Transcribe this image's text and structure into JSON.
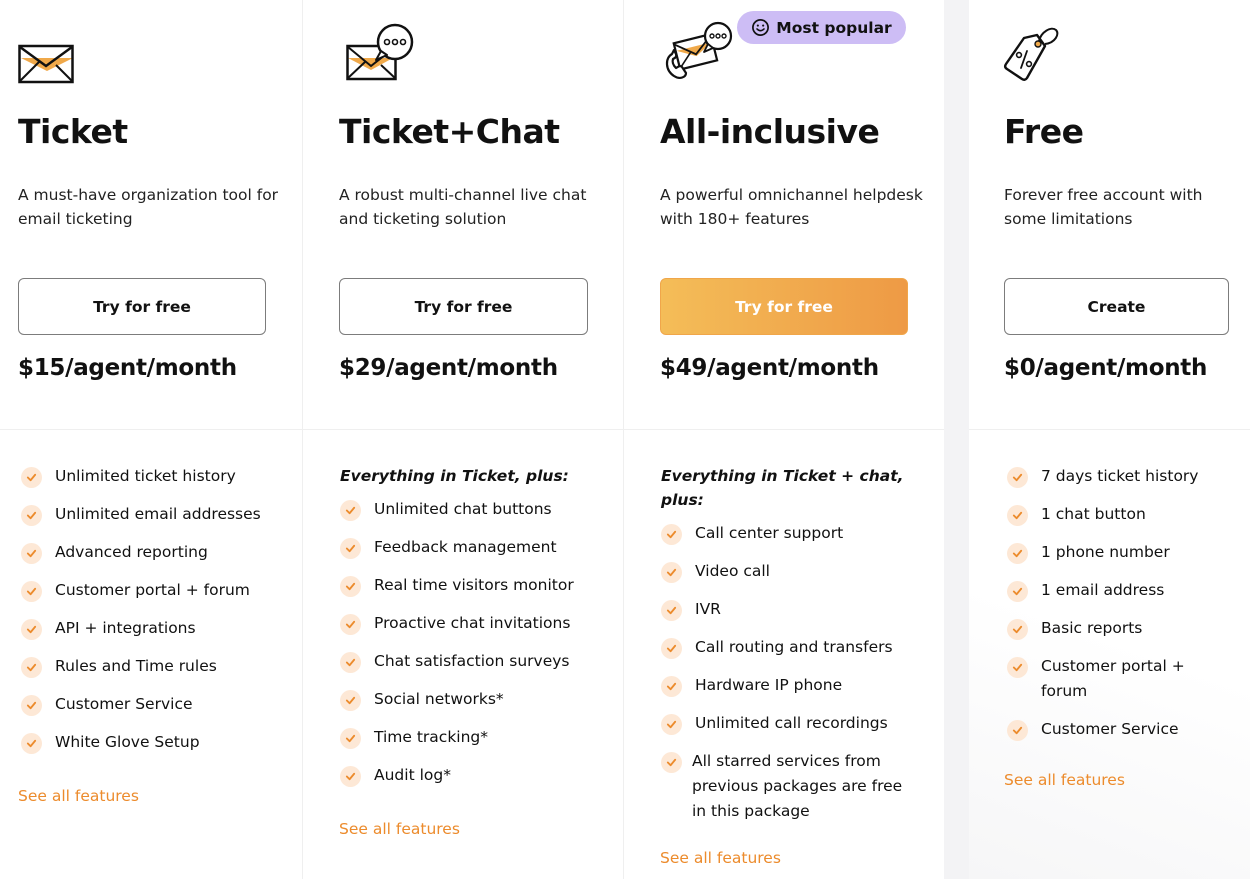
{
  "accent_color": "#ec8b2c",
  "badge_color": "#cdbdf5",
  "plans": [
    {
      "icon": "envelope-icon",
      "title": "Ticket",
      "description": "A must-have organization tool for email ticketing",
      "cta": "Try for free",
      "price": "$15/agent/month",
      "lead": "",
      "features": [
        "Unlimited ticket history",
        "Unlimited email addresses",
        "Advanced reporting",
        "Customer portal + forum",
        "API + integrations",
        "Rules and Time rules",
        "Customer Service",
        "White Glove Setup"
      ],
      "see_all": "See all features"
    },
    {
      "icon": "envelope-chat-icon",
      "title": "Ticket+Chat",
      "description": "A robust multi-channel live chat and ticketing solution",
      "cta": "Try for free",
      "price": "$29/agent/month",
      "lead": "Everything in Ticket, plus:",
      "features": [
        "Unlimited chat buttons",
        "Feedback management",
        "Real time visitors monitor",
        "Proactive chat invitations",
        "Chat satisfaction surveys",
        "Social networks*",
        "Time tracking*",
        "Audit log*"
      ],
      "see_all": "See all features"
    },
    {
      "icon": "phone-envelope-chat-icon",
      "badge": "Most popular",
      "title": "All-inclusive",
      "description": "A powerful omnichannel helpdesk with 180+ features",
      "cta": "Try for free",
      "price": "$49/agent/month",
      "lead": "Everything in Ticket + chat, plus:",
      "features": [
        "Call center support",
        "Video call",
        "IVR",
        "Call routing and transfers",
        "Hardware IP phone",
        "Unlimited call recordings",
        "All starred services from previous packages are free in this package"
      ],
      "see_all": "See all features"
    },
    {
      "icon": "price-tag-icon",
      "title": "Free",
      "description": "Forever free account with some limitations",
      "cta": "Create",
      "price": "$0/agent/month",
      "lead": "",
      "features": [
        "7 days ticket history",
        "1 chat button",
        "1 phone number",
        "1 email address",
        "Basic reports",
        "Customer portal + forum",
        "Customer Service"
      ],
      "see_all": "See all features"
    }
  ]
}
